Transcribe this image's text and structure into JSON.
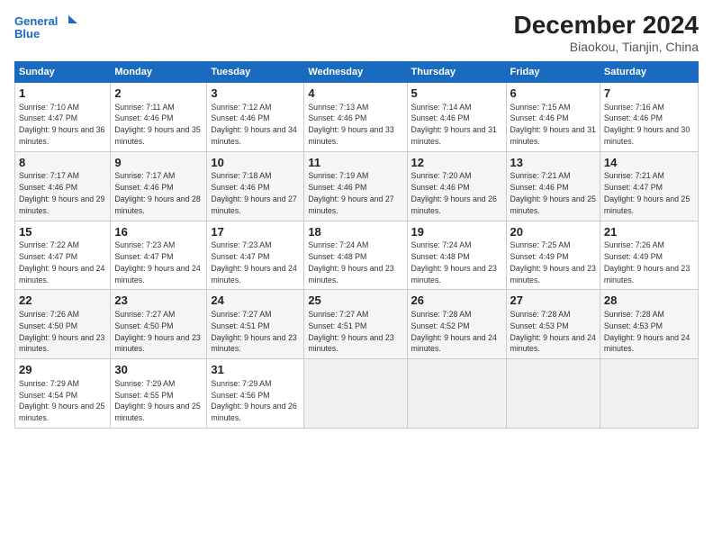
{
  "header": {
    "logo_line1": "General",
    "logo_line2": "Blue",
    "title": "December 2024",
    "subtitle": "Biaokou, Tianjin, China"
  },
  "columns": [
    "Sunday",
    "Monday",
    "Tuesday",
    "Wednesday",
    "Thursday",
    "Friday",
    "Saturday"
  ],
  "weeks": [
    [
      {
        "day": "1",
        "sunrise": "7:10 AM",
        "sunset": "4:47 PM",
        "daylight": "9 hours and 36 minutes."
      },
      {
        "day": "2",
        "sunrise": "7:11 AM",
        "sunset": "4:46 PM",
        "daylight": "9 hours and 35 minutes."
      },
      {
        "day": "3",
        "sunrise": "7:12 AM",
        "sunset": "4:46 PM",
        "daylight": "9 hours and 34 minutes."
      },
      {
        "day": "4",
        "sunrise": "7:13 AM",
        "sunset": "4:46 PM",
        "daylight": "9 hours and 33 minutes."
      },
      {
        "day": "5",
        "sunrise": "7:14 AM",
        "sunset": "4:46 PM",
        "daylight": "9 hours and 31 minutes."
      },
      {
        "day": "6",
        "sunrise": "7:15 AM",
        "sunset": "4:46 PM",
        "daylight": "9 hours and 31 minutes."
      },
      {
        "day": "7",
        "sunrise": "7:16 AM",
        "sunset": "4:46 PM",
        "daylight": "9 hours and 30 minutes."
      }
    ],
    [
      {
        "day": "8",
        "sunrise": "7:17 AM",
        "sunset": "4:46 PM",
        "daylight": "9 hours and 29 minutes."
      },
      {
        "day": "9",
        "sunrise": "7:17 AM",
        "sunset": "4:46 PM",
        "daylight": "9 hours and 28 minutes."
      },
      {
        "day": "10",
        "sunrise": "7:18 AM",
        "sunset": "4:46 PM",
        "daylight": "9 hours and 27 minutes."
      },
      {
        "day": "11",
        "sunrise": "7:19 AM",
        "sunset": "4:46 PM",
        "daylight": "9 hours and 27 minutes."
      },
      {
        "day": "12",
        "sunrise": "7:20 AM",
        "sunset": "4:46 PM",
        "daylight": "9 hours and 26 minutes."
      },
      {
        "day": "13",
        "sunrise": "7:21 AM",
        "sunset": "4:46 PM",
        "daylight": "9 hours and 25 minutes."
      },
      {
        "day": "14",
        "sunrise": "7:21 AM",
        "sunset": "4:47 PM",
        "daylight": "9 hours and 25 minutes."
      }
    ],
    [
      {
        "day": "15",
        "sunrise": "7:22 AM",
        "sunset": "4:47 PM",
        "daylight": "9 hours and 24 minutes."
      },
      {
        "day": "16",
        "sunrise": "7:23 AM",
        "sunset": "4:47 PM",
        "daylight": "9 hours and 24 minutes."
      },
      {
        "day": "17",
        "sunrise": "7:23 AM",
        "sunset": "4:47 PM",
        "daylight": "9 hours and 24 minutes."
      },
      {
        "day": "18",
        "sunrise": "7:24 AM",
        "sunset": "4:48 PM",
        "daylight": "9 hours and 23 minutes."
      },
      {
        "day": "19",
        "sunrise": "7:24 AM",
        "sunset": "4:48 PM",
        "daylight": "9 hours and 23 minutes."
      },
      {
        "day": "20",
        "sunrise": "7:25 AM",
        "sunset": "4:49 PM",
        "daylight": "9 hours and 23 minutes."
      },
      {
        "day": "21",
        "sunrise": "7:26 AM",
        "sunset": "4:49 PM",
        "daylight": "9 hours and 23 minutes."
      }
    ],
    [
      {
        "day": "22",
        "sunrise": "7:26 AM",
        "sunset": "4:50 PM",
        "daylight": "9 hours and 23 minutes."
      },
      {
        "day": "23",
        "sunrise": "7:27 AM",
        "sunset": "4:50 PM",
        "daylight": "9 hours and 23 minutes."
      },
      {
        "day": "24",
        "sunrise": "7:27 AM",
        "sunset": "4:51 PM",
        "daylight": "9 hours and 23 minutes."
      },
      {
        "day": "25",
        "sunrise": "7:27 AM",
        "sunset": "4:51 PM",
        "daylight": "9 hours and 23 minutes."
      },
      {
        "day": "26",
        "sunrise": "7:28 AM",
        "sunset": "4:52 PM",
        "daylight": "9 hours and 24 minutes."
      },
      {
        "day": "27",
        "sunrise": "7:28 AM",
        "sunset": "4:53 PM",
        "daylight": "9 hours and 24 minutes."
      },
      {
        "day": "28",
        "sunrise": "7:28 AM",
        "sunset": "4:53 PM",
        "daylight": "9 hours and 24 minutes."
      }
    ],
    [
      {
        "day": "29",
        "sunrise": "7:29 AM",
        "sunset": "4:54 PM",
        "daylight": "9 hours and 25 minutes."
      },
      {
        "day": "30",
        "sunrise": "7:29 AM",
        "sunset": "4:55 PM",
        "daylight": "9 hours and 25 minutes."
      },
      {
        "day": "31",
        "sunrise": "7:29 AM",
        "sunset": "4:56 PM",
        "daylight": "9 hours and 26 minutes."
      },
      null,
      null,
      null,
      null
    ]
  ]
}
